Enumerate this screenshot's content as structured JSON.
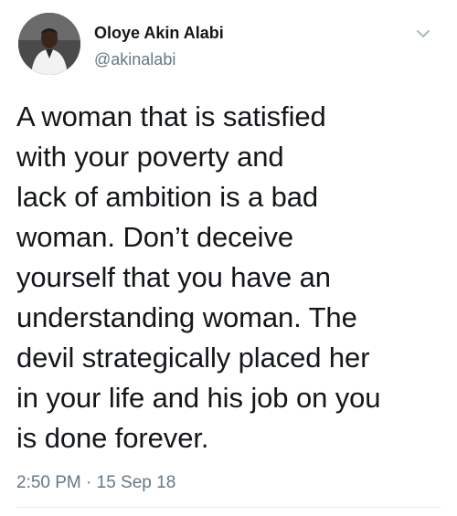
{
  "user": {
    "display_name": "Oloye Akin Alabi",
    "handle": "@akinalabi",
    "avatar_icon": "profile-photo"
  },
  "menu": {
    "icon": "chevron-down-icon"
  },
  "tweet": {
    "lines": [
      "A woman that is satisfied",
      "with your poverty and",
      "lack of ambition is a bad",
      "woman. Don’t deceive",
      "yourself that you have an",
      "understanding woman. The",
      "devil strategically placed her",
      "in your life and his job on you",
      "is done forever."
    ],
    "timestamp": "2:50 PM · 15 Sep 18"
  },
  "colors": {
    "text": "#14171a",
    "secondary": "#657786",
    "divider": "#e6ecf0"
  }
}
